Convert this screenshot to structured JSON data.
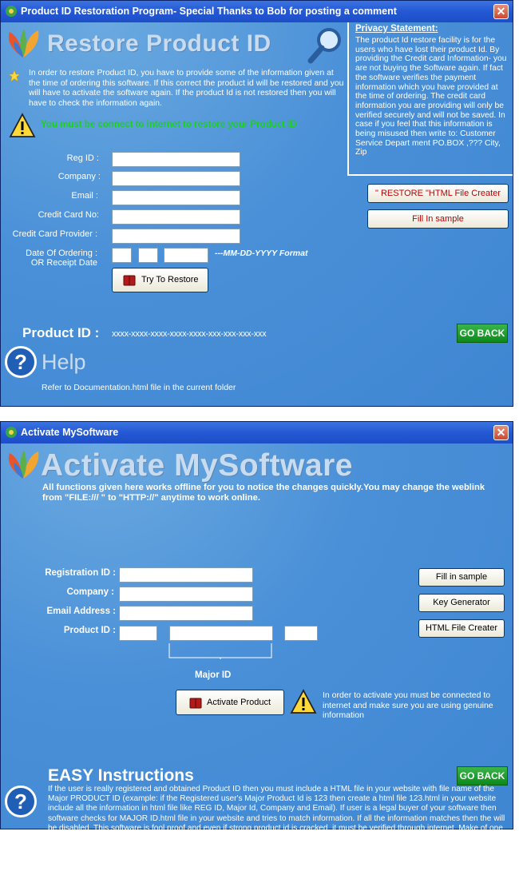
{
  "window1": {
    "title": "Product ID Restoration Program- Special Thanks to Bob for posting a comment",
    "close": "✕",
    "heading": "Restore Product ID",
    "intro": "In order to restore Product ID, you have to provide some of the information given at the time of ordering this software. If this correct the product id will be restored and you will have to activate the software again. If the product Id is not restored then you will have to check the information again.",
    "warning": "You must be connect to internet to restore your Product ID",
    "privacy_title": "Privacy Statement:",
    "privacy_text": "The product Id restore facility is for the users who have lost their product Id. By providing the Credit card Information- you are not buying the Software again. If fact the software verifies the payment information which you have provided at the time of ordering. The credit card information you are providing will only be verified securely and will not be saved. In case if you feel that this information is being misused then write to: Customer Service Depart ment PO.BOX ,??? City, Zip",
    "restore_html_button": "\" RESTORE \"HTML File Creater",
    "fill_sample_button": "Fill In sample",
    "labels": {
      "reg_id": "Reg ID :",
      "company": "Company :",
      "email": "Email :",
      "credit_card_no": "Credit Card No:",
      "credit_card_provider": "Credit Card Provider :",
      "date_line1": "Date Of Ordering :",
      "date_line2": "OR Receipt Date"
    },
    "date_format_hint": "---MM-DD-YYYY Format",
    "try_restore_button": "Try To Restore",
    "product_id_label": "Product ID :",
    "product_id_value": "xxxx-xxxx-xxxx-xxxx-xxxx-xxx-xxx-xxx-xxx",
    "go_back": "GO BACK",
    "help_heading": "Help",
    "help_text": "Refer to Documentation.html file in the current folder"
  },
  "window2": {
    "title": "Activate MySoftware",
    "close": "✕",
    "heading": "Activate MySoftware",
    "subtitle": "All functions given here works offline for you to notice the changes quickly.You may change the weblink from \"FILE:/// \" to \"HTTP://\" anytime to work online.",
    "labels": {
      "registration_id": "Registration ID :",
      "company": "Company :",
      "email_address": "Email Address :",
      "product_id": "Product ID :"
    },
    "major_id_label": "Major ID",
    "fill_sample_button": "Fill in sample",
    "key_generator_button": "Key Generator",
    "html_file_button": "HTML File Creater",
    "activate_button": "Activate Product",
    "activate_note": "In order to activate you must be connected to internet and make sure you are using genuine information",
    "instructions_heading": "EASY Instructions",
    "go_back": "GO BACK",
    "instructions_text": "If the user is really registered and obtained Product ID then you must include a HTML file in your website with file name of the Major PRODUCT ID (example: if the Registered user's Major Product Id is 123 then create a html file 123.html in your website include all the information in html file like REG ID, Major Id, Company and Email). If user is a legal buyer of your software then software checks for MAJOR ID.html file in your website and tries to match information. If all the information matches then the will be disabled. This software is fool proof and even if strong product id is cracked, it must be verified through internet. Make of one thing: html file should be created using Note pad with instruction one below the other or use HTML file creater"
  }
}
